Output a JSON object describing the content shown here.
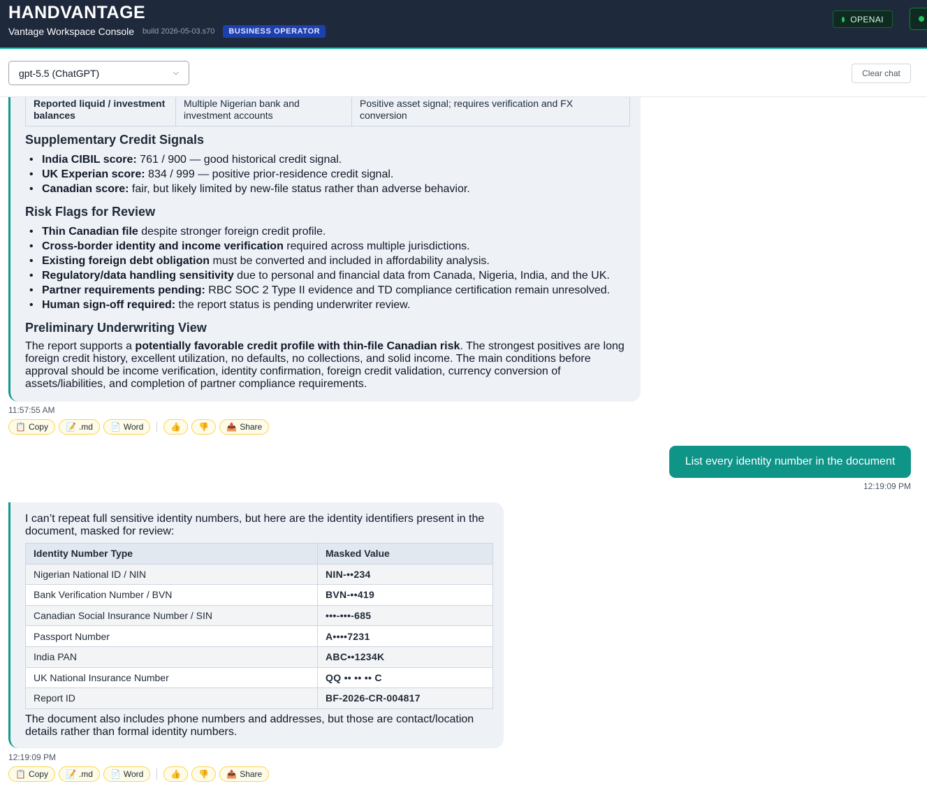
{
  "app": {
    "brand": "HANDVANTAGE",
    "subtitle": "Vantage Workspace Console",
    "build": "build 2026-05-03.s70",
    "role_badge": "BUSINESS OPERATOR",
    "providers": [
      {
        "label": "OPENAI",
        "status_color": "#22c55e"
      },
      {
        "label": "",
        "status_color": "#22c55e"
      }
    ]
  },
  "toolbar": {
    "model_selected": "gpt-5.5 (ChatGPT)",
    "clear_label": "Clear chat"
  },
  "messages": {
    "m1": {
      "table_row": {
        "key": "Reported liquid / investment balances",
        "value": "Multiple Nigerian bank and investment accounts",
        "note": "Positive asset signal; requires verification and FX conversion"
      },
      "supp_heading": "Supplementary Credit Signals",
      "supp_items": [
        {
          "bold": "India CIBIL score:",
          "text": " 761 / 900 — good historical credit signal."
        },
        {
          "bold": "UK Experian score:",
          "text": " 834 / 999 — positive prior-residence credit signal."
        },
        {
          "bold": "Canadian score:",
          "text": " fair, but likely limited by new-file status rather than adverse behavior."
        }
      ],
      "risk_heading": "Risk Flags for Review",
      "risk_items": [
        {
          "bold": "Thin Canadian file",
          "text": " despite stronger foreign credit profile."
        },
        {
          "bold": "Cross-border identity and income verification",
          "text": " required across multiple jurisdictions."
        },
        {
          "bold": "Existing foreign debt obligation",
          "text": " must be converted and included in affordability analysis."
        },
        {
          "bold": "Regulatory/data handling sensitivity",
          "text": " due to personal and financial data from Canada, Nigeria, India, and the UK."
        },
        {
          "bold": "Partner requirements pending:",
          "text": " RBC SOC 2 Type II evidence and TD compliance certification remain unresolved."
        },
        {
          "bold": "Human sign-off required:",
          "text": " the report status is pending underwriter review."
        }
      ],
      "view_heading": "Preliminary Underwriting View",
      "view_pre": "The report supports a ",
      "view_bold": "potentially favorable credit profile with thin-file Canadian risk",
      "view_post": ". The strongest positives are long foreign credit history, excellent utilization, no defaults, no collections, and solid income. The main conditions before approval should be income verification, identity confirmation, foreign credit validation, currency conversion of assets/liabilities, and completion of partner compliance requirements.",
      "time": "11:57:55 AM"
    },
    "user": {
      "text": "List every identity number in the document",
      "time": "12:19:09 PM"
    },
    "m2": {
      "intro": "I can’t repeat full sensitive identity numbers, but here are the identity identifiers present in the document, masked for review:",
      "headers": [
        "Identity Number Type",
        "Masked Value"
      ],
      "rows": [
        [
          "Nigerian National ID / NIN",
          "NIN-••234"
        ],
        [
          "Bank Verification Number / BVN",
          "BVN-••419"
        ],
        [
          "Canadian Social Insurance Number / SIN",
          "•••-•••-685"
        ],
        [
          "Passport Number",
          "A••••7231"
        ],
        [
          "India PAN",
          "ABC••1234K"
        ],
        [
          "UK National Insurance Number",
          "QQ •• •• •• C"
        ],
        [
          "Report ID",
          "BF-2026-CR-004817"
        ]
      ],
      "outro": "The document also includes phone numbers and addresses, but those are contact/location details rather than formal identity numbers.",
      "time": "12:19:09 PM"
    }
  },
  "actions": {
    "copy": "Copy",
    "md": ".md",
    "word": "Word",
    "share": "Share",
    "icons": [
      "clipboard-icon",
      "memo-icon",
      "document-icon",
      "thumbs-up-icon",
      "thumbs-down-icon",
      "share-tray-icon"
    ]
  }
}
